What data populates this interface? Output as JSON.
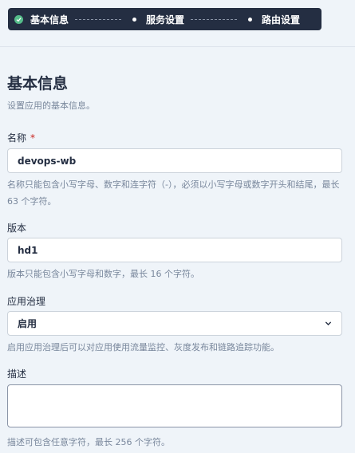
{
  "steps": [
    {
      "label": "基本信息",
      "status": "done"
    },
    {
      "label": "服务设置",
      "status": "pending"
    },
    {
      "label": "路由设置",
      "status": "pending"
    }
  ],
  "form": {
    "title": "基本信息",
    "subtitle": "设置应用的基本信息。",
    "name": {
      "label": "名称",
      "required_mark": "*",
      "value": "devops-wb",
      "hint": "名称只能包含小写字母、数字和连字符（-），必须以小写字母或数字开头和结尾，最长 63 个字符。"
    },
    "version": {
      "label": "版本",
      "value": "hd1",
      "hint": "版本只能包含小写字母和数字，最长 16 个字符。"
    },
    "governance": {
      "label": "应用治理",
      "selected": "启用",
      "hint": "启用应用治理后可以对应用使用流量监控、灰度发布和链路追踪功能。"
    },
    "description": {
      "label": "描述",
      "value": "",
      "hint": "描述可包含任意字符，最长 256 个字符。"
    }
  },
  "colors": {
    "nav_bg": "#242e42",
    "done": "#55bc8a",
    "page_bg": "#eff4f9",
    "required": "#ca2621"
  },
  "icons": {
    "done_step": "check-circle-icon",
    "pending_step": "dot-icon",
    "select_toggle": "chevron-down-icon"
  }
}
